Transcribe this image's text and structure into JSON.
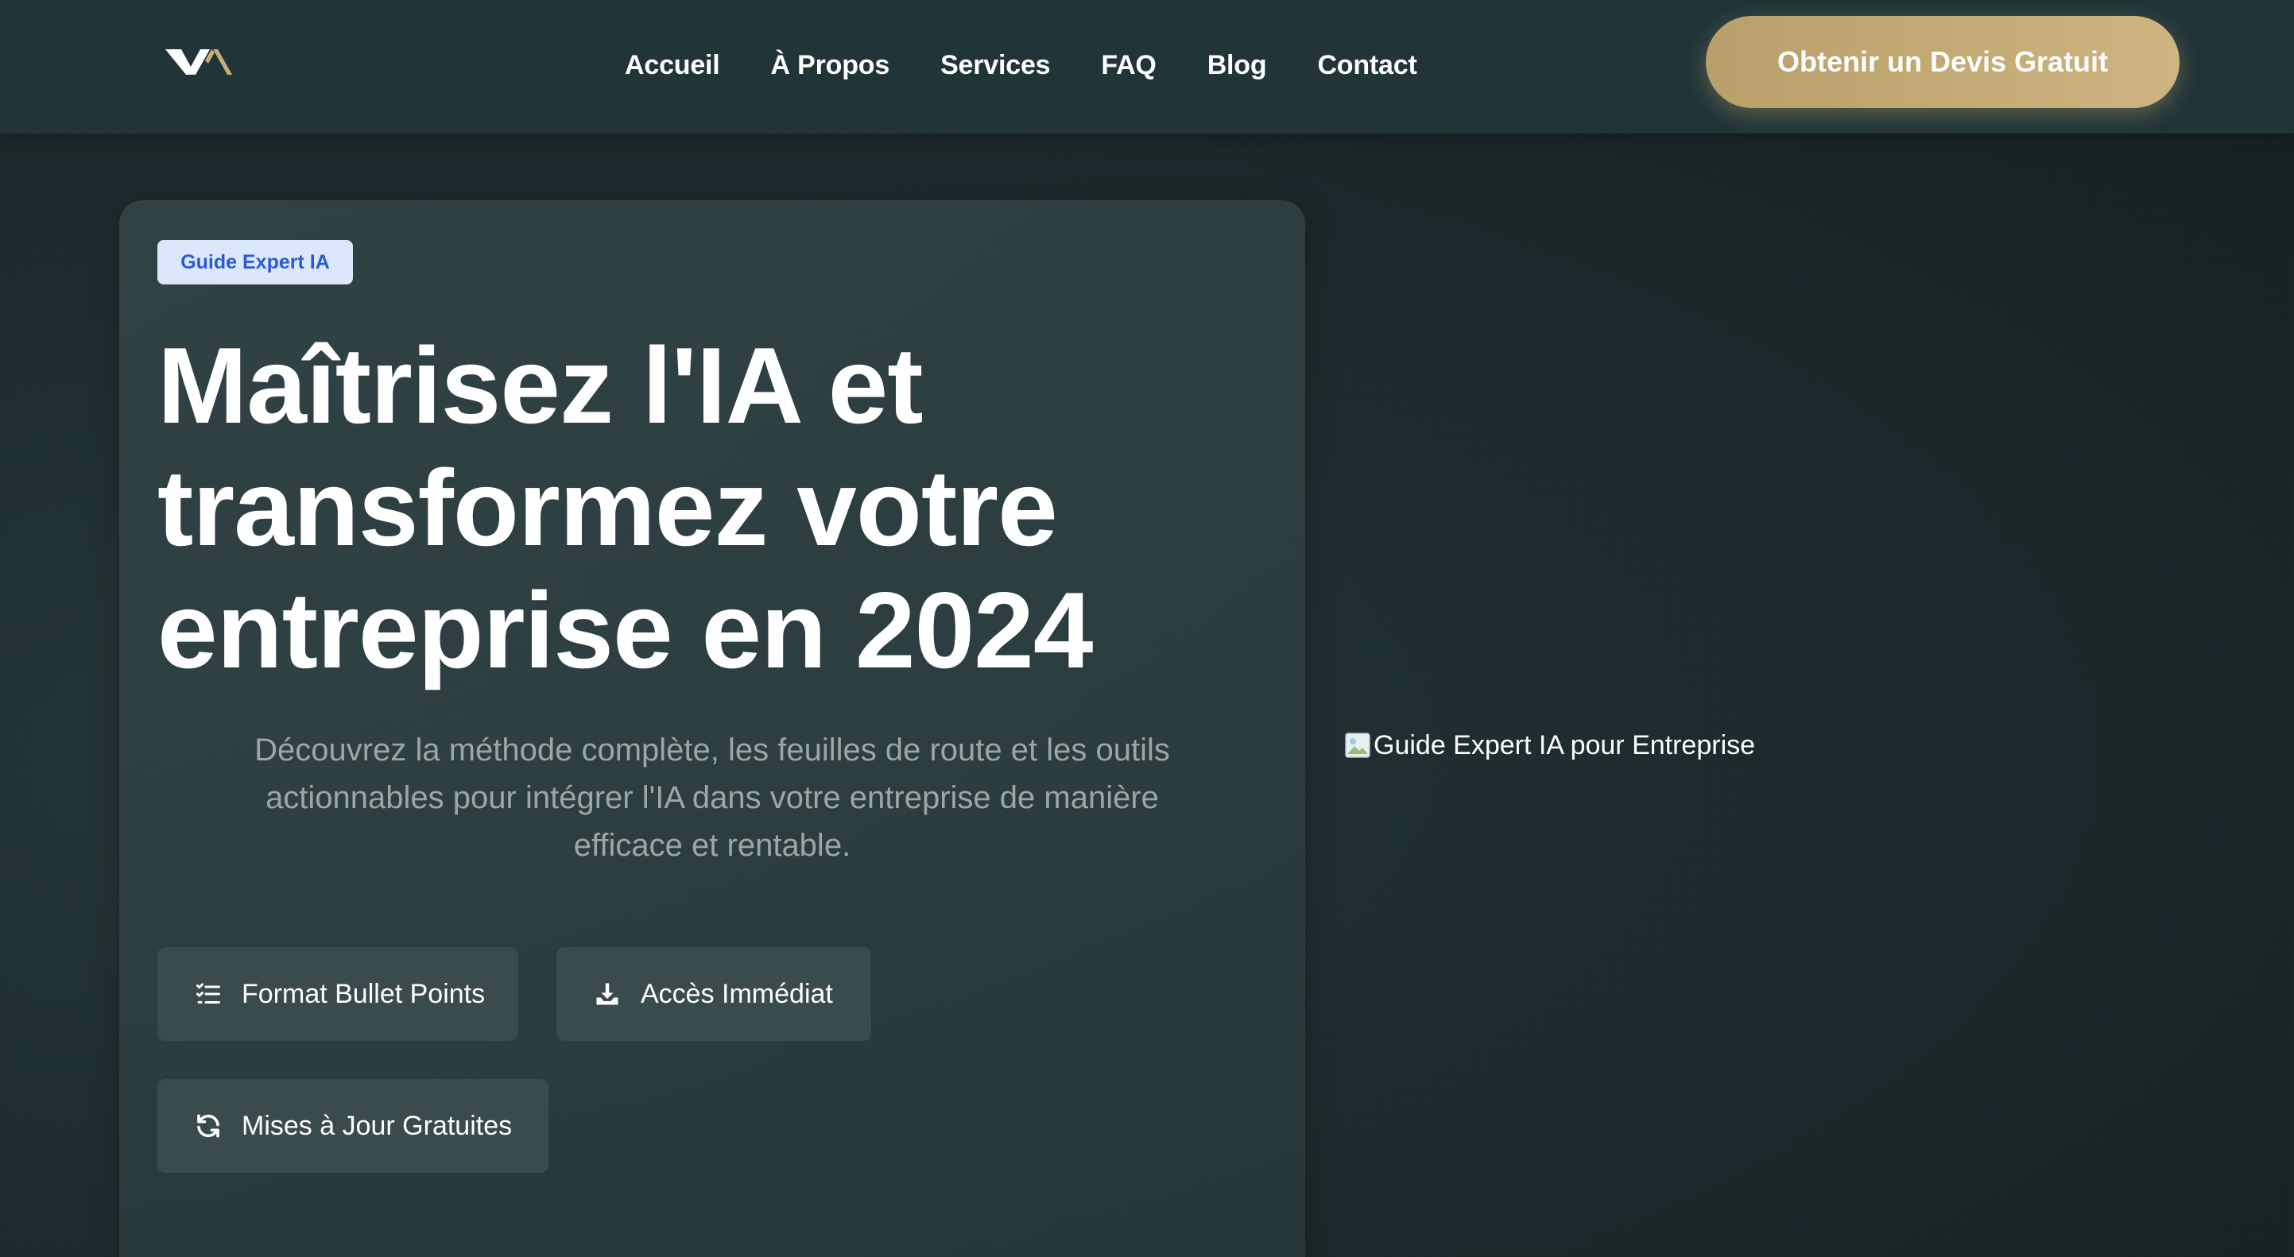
{
  "header": {
    "logo_name": "brand-logo",
    "nav": [
      {
        "label": "Accueil"
      },
      {
        "label": "À Propos"
      },
      {
        "label": "Services"
      },
      {
        "label": "FAQ"
      },
      {
        "label": "Blog"
      },
      {
        "label": "Contact"
      }
    ],
    "cta_label": "Obtenir un Devis Gratuit",
    "cta_color": "#c8ad77"
  },
  "hero": {
    "badge": "Guide Expert IA",
    "title_lines": [
      "Maîtrisez l'IA et",
      "transformez votre",
      "entreprise en 2024"
    ],
    "description": "Découvrez la méthode complète, les feuilles de route et les outils actionnables pour intégrer l'IA dans votre entreprise de manière efficace et rentable.",
    "features": [
      {
        "label": "Format Bullet Points",
        "icon": "list-check-icon"
      },
      {
        "label": "Accès Immédiat",
        "icon": "download-icon"
      },
      {
        "label": "Mises à Jour Gratuites",
        "icon": "refresh-icon"
      }
    ]
  },
  "image": {
    "alt": "Guide Expert IA pour Entreprise",
    "icon": "broken-image-icon"
  },
  "colors": {
    "background": "#1d2d2f",
    "header": "#213538",
    "badge_bg": "#dbe7fb",
    "badge_text": "#2a5bd7",
    "feature_bg": "#3a4b4d",
    "description": "#9aa7a8"
  }
}
